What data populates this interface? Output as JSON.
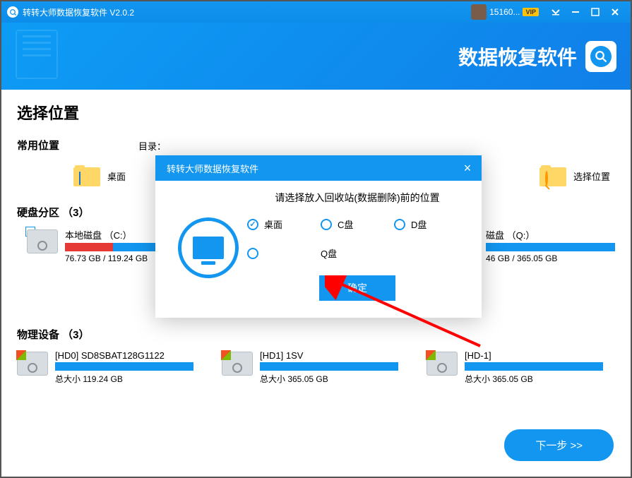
{
  "titlebar": {
    "title": "转转大师数据恢复软件 V2.0.2",
    "username": "15160...",
    "vip": "VIP"
  },
  "banner": {
    "title": "数据恢复软件"
  },
  "content": {
    "h1": "选择位置",
    "common_label": "常用位置",
    "dir_label": "目录：",
    "common": {
      "desktop": "桌面",
      "choose": "选择位置"
    },
    "partition_label": "硬盘分区 （3）",
    "disks": [
      {
        "name": "本地磁盘 （C:）",
        "size": "76.73 GB / 119.24 GB",
        "red_pct": 35
      },
      {
        "name": "磁盘 （Q:）",
        "size": "46 GB / 365.05 GB",
        "red_pct": 0,
        "trunc_size": true
      }
    ],
    "physical_label": "物理设备 （3）",
    "phys": [
      {
        "name": "[HD0] SD8SBAT128G1122",
        "size": "总大小 119.24 GB"
      },
      {
        "name": "[HD1] 1SV",
        "size": "总大小 365.05 GB"
      },
      {
        "name": "[HD-1]",
        "size": "总大小 365.05 GB"
      }
    ],
    "next": "下一步 >>"
  },
  "dialog": {
    "title": "转转大师数据恢复软件",
    "prompt": "请选择放入回收站(数据删除)前的位置",
    "opts": {
      "desktop": "桌面",
      "c": "C盘",
      "d": "D盘",
      "q": "Q盘"
    },
    "confirm": "确定"
  }
}
